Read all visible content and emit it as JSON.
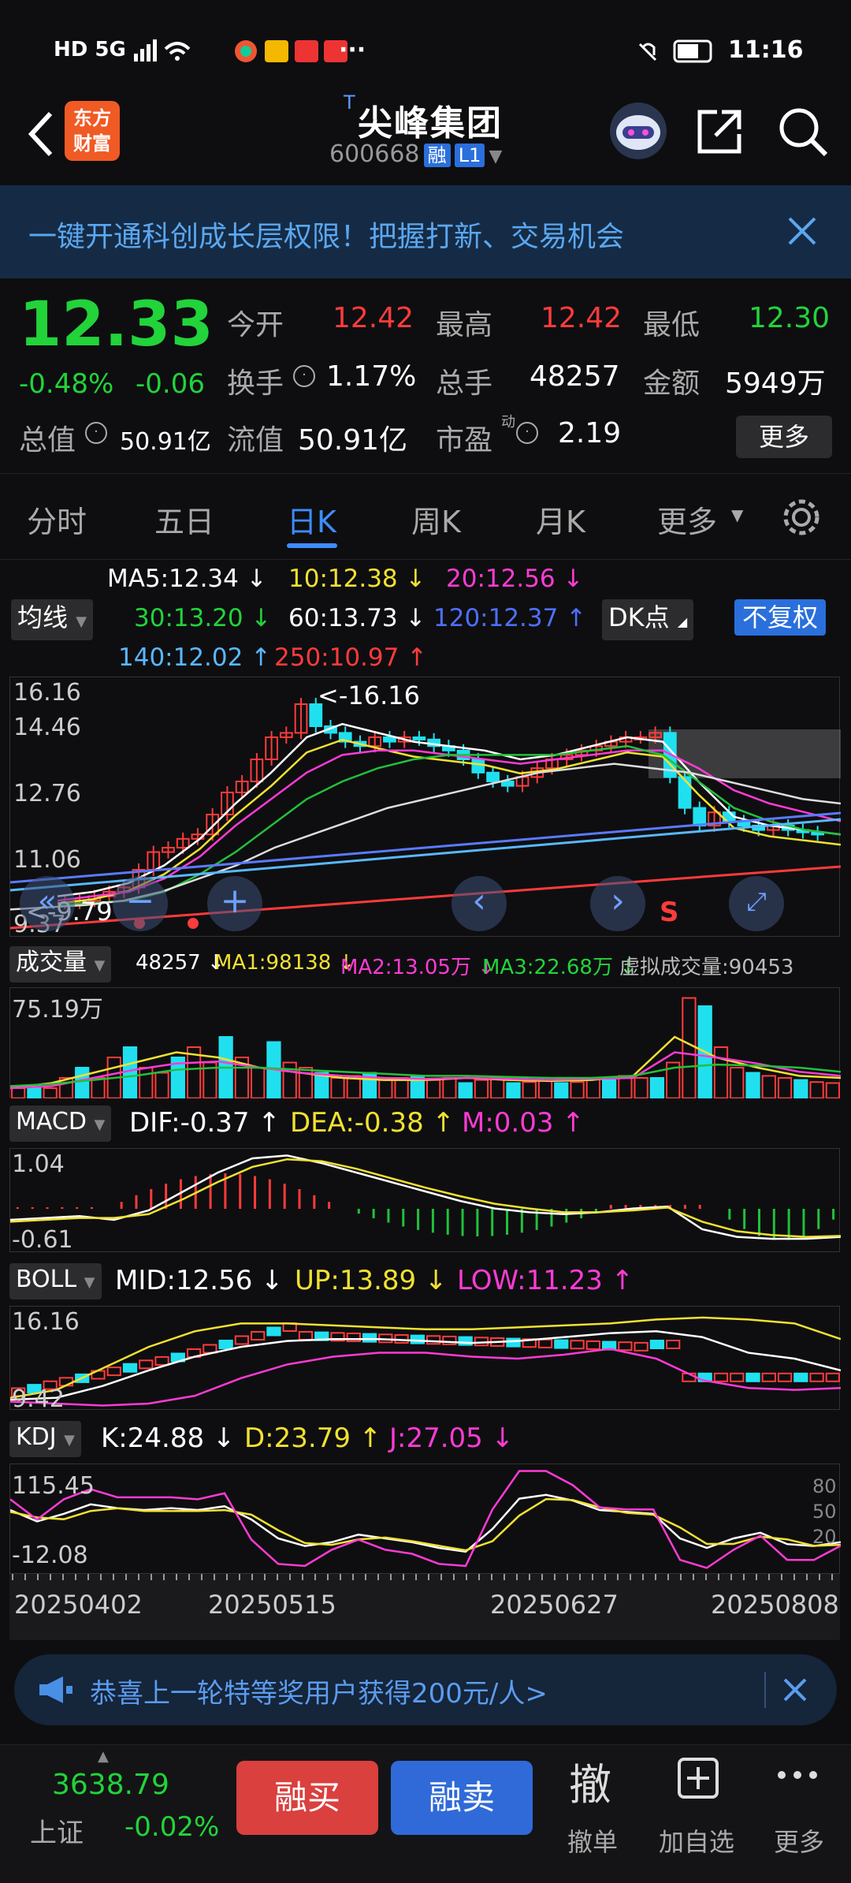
{
  "status": {
    "left_icons": "HD 5G",
    "time": "11:16",
    "menu": "···",
    "meituan": "美团"
  },
  "header": {
    "name": "尖峰集团",
    "prefix": "T",
    "code": "600668",
    "badge_rong": "融",
    "badge_l1": "L1",
    "logo_line1": "东方",
    "logo_line2": "财富"
  },
  "banner": {
    "text": "一键开通科创成长层权限！把握打新、交易机会"
  },
  "quote": {
    "price": "12.33",
    "change_pct": "-0.48%",
    "change": "-0.06",
    "open_label": "今开",
    "open": "12.42",
    "high_label": "最高",
    "high": "12.42",
    "low_label": "最低",
    "low": "12.30",
    "turnover_label": "换手",
    "turnover": "1.17%",
    "volume_label": "总手",
    "volume": "48257",
    "amount_label": "金额",
    "amount": "5949万",
    "mktcap_label": "总值",
    "mktcap": "50.91亿",
    "float_label": "流值",
    "float": "50.91亿",
    "pe_label": "市盈",
    "pe_sup": "动",
    "pe": "2.19",
    "more": "更多"
  },
  "tabs": [
    "分时",
    "五日",
    "日K",
    "周K",
    "月K",
    "更多"
  ],
  "ma": {
    "chip": "均线",
    "ma5": "MA5:12.34 ↓",
    "ma10": "10:12.38 ↓",
    "ma20": "20:12.56 ↓",
    "ma30": "30:13.20 ↓",
    "ma60": "60:13.73 ↓",
    "ma120": "120:12.37 ↑",
    "ma140": "140:12.02 ↑",
    "ma250": "250:10.97 ↑",
    "dk": "DK点",
    "fq": "不复权"
  },
  "kaxis": {
    "t1": "16.16",
    "t2": "14.46",
    "t3": "12.76",
    "t4": "11.06",
    "t5": "9.37",
    "hi": "<-16.16",
    "lo": "<-9.79",
    "s": "S"
  },
  "vol": {
    "chip": "成交量",
    "v": "48257 ↓",
    "ma1": "MA1:98138 ↓",
    "ma2": "MA2:13.05万 ↓",
    "ma3": "MA3:22.68万 ↓",
    "virtual": "虚拟成交量:90453",
    "top": "75.19万"
  },
  "macd": {
    "chip": "MACD",
    "dif": "DIF:-0.37 ↑",
    "dea": "DEA:-0.38 ↑",
    "m": "M:0.03 ↑",
    "top": "1.04",
    "bottom": "-0.61"
  },
  "boll": {
    "chip": "BOLL",
    "mid": "MID:12.56 ↓",
    "up": "UP:13.89 ↓",
    "low": "LOW:11.23 ↑",
    "top": "16.16",
    "bottom": "9.42"
  },
  "kdj": {
    "chip": "KDJ",
    "k": "K:24.88 ↓",
    "d": "D:23.79 ↑",
    "j": "J:27.05 ↓",
    "top": "115.45",
    "bottom": "-12.08",
    "r80": "80",
    "r50": "50",
    "r20": "20"
  },
  "dates": [
    "20250402",
    "20250515",
    "20250627",
    "20250808"
  ],
  "promo": {
    "text": "恭喜上一轮特等奖用户获得200元/人>"
  },
  "bottom": {
    "index_value": "3638.79",
    "index_name": "上证",
    "index_change": "-0.02%",
    "buy": "融买",
    "sell": "融卖",
    "cancel_icon": "撤",
    "cancel": "撤单",
    "add": "加自选",
    "more": "更多"
  }
}
